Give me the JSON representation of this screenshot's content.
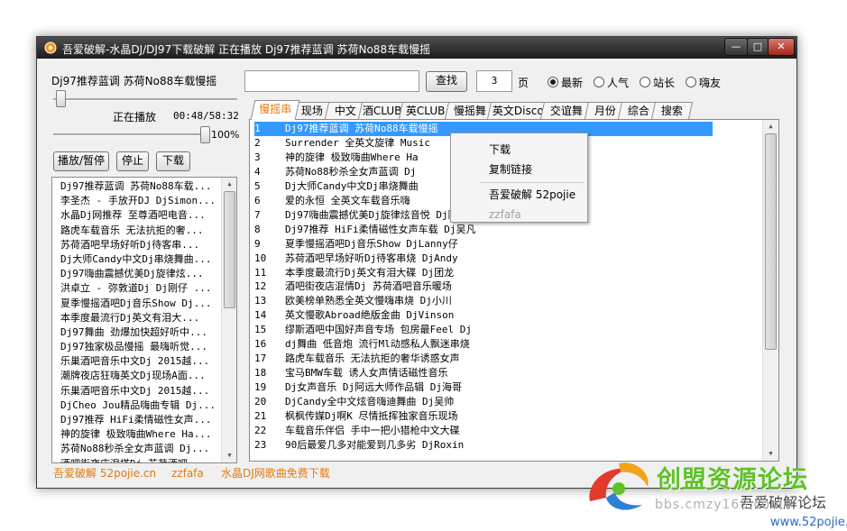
{
  "window": {
    "title": "吾爱破解-水晶DJ/DJ97下载破解 正在播放 Dj97推荐蓝调 苏荷No88车载慢摇"
  },
  "player": {
    "now_title": "Dj97推荐蓝调 苏荷No88车载慢摇",
    "status_label": "正在播放",
    "time": "00:48/58:32",
    "volume": "100%",
    "progress": 0.014,
    "volume_level": 1.0,
    "play_pause": "播放/暂停",
    "stop": "停止",
    "download": "下载"
  },
  "search": {
    "value": "",
    "button": "查找",
    "page": "3",
    "page_suffix": "页"
  },
  "sort": [
    {
      "label": "最新",
      "checked": true
    },
    {
      "label": "人气",
      "checked": false
    },
    {
      "label": "站长",
      "checked": false
    },
    {
      "label": "嗨友",
      "checked": false
    }
  ],
  "tabs": [
    "慢摇串",
    "现场",
    "中文",
    "酒CLUB",
    "英CLUB",
    "慢摇舞",
    "英文Disco",
    "交谊舞",
    "月份",
    "综合",
    "搜索"
  ],
  "active_tab": 0,
  "playlist": [
    "Dj97推荐蓝调 苏荷No88车载...",
    "李圣杰 - 手放开DJ DjSimon...",
    "水晶Dj网推荐 至尊酒吧电音...",
    "路虎车载音乐 无法抗拒的奢...",
    "苏荷酒吧早场好听Dj待客串...",
    "Dj大师Candy中文Dj串烧舞曲...",
    "Dj97嗨曲震撼优美Dj旋律炫...",
    "洪卓立 - 弥敦道Dj Dj刚仔 ...",
    "夏季慢摇酒吧Dj音乐Show Dj...",
    "本季度最流行Dj英文有泪大...",
    "Dj97舞曲 劲爆加快超好听中...",
    "Dj97独家极品慢摇 最嗨听觉...",
    "乐巢酒吧音乐中文Dj 2015越...",
    "潮牌夜店狂嗨英文Dj现场A面...",
    "乐巢酒吧音乐中文Dj 2015越...",
    "DjCheo Jou精品嗨曲专辑 Dj...",
    "Dj97推荐 HiFi柔情磁性女声...",
    "神的旋律 极致嗨曲Where Ha...",
    "苏荷No88秒杀全女声蓝调 Dj...",
    "酒吧街夜店混搭Dj 苏荷酒吧..."
  ],
  "tracks": [
    {
      "no": "1",
      "title": "Dj97推荐蓝调 苏荷No88车载慢摇"
    },
    {
      "no": "2",
      "title": "Surrender 全英文旋律 Music"
    },
    {
      "no": "3",
      "title": "神的旋律 极致嗨曲Where Ha"
    },
    {
      "no": "4",
      "title": "苏荷No88秒杀全女声蓝调 Dj"
    },
    {
      "no": "5",
      "title": "Dj大师Candy中文Dj串烧舞曲"
    },
    {
      "no": "6",
      "title": "爱的永恒 全英文车载音乐嗨"
    },
    {
      "no": "7",
      "title": "Dj97嗨曲震撼优美Dj旋律炫音悦 Dj阿文"
    },
    {
      "no": "8",
      "title": "Dj97推荐 HiFi柔情磁性女声车载 Dj吴凡"
    },
    {
      "no": "9",
      "title": "夏季慢摇酒吧Dj音乐Show DjLanny仔"
    },
    {
      "no": "10",
      "title": "苏荷酒吧早场好听Dj待客串烧 DjAndy"
    },
    {
      "no": "11",
      "title": "本季度最流行Dj英文有泪大碟 Dj团龙"
    },
    {
      "no": "12",
      "title": "酒吧街夜店混情Dj 苏荷酒吧音乐暖场"
    },
    {
      "no": "13",
      "title": "欧美榜单熟悉全英文慢嗨串烧 Dj小川"
    },
    {
      "no": "14",
      "title": "英文慢歌Abroad绝版金曲 DjVinson"
    },
    {
      "no": "15",
      "title": "缪斯酒吧中国好声音专场 包房最Feel Dj"
    },
    {
      "no": "16",
      "title": "dj舞曲 低音炮 流行Ml动感私人飘迷串烧"
    },
    {
      "no": "17",
      "title": "路虎车载音乐 无法抗拒的奢华诱惑女声"
    },
    {
      "no": "18",
      "title": "宝马BMW车载 诱人女声情话磁性音乐"
    },
    {
      "no": "19",
      "title": "Dj女声音乐 Dj阿远大师作品辑 Dj海哥"
    },
    {
      "no": "20",
      "title": "DjCandy全中文炫音嗨迪舞曲 Dj吴帅"
    },
    {
      "no": "21",
      "title": "枫枫传媒Dj啊K 尽情抵挥独家音乐现场"
    },
    {
      "no": "22",
      "title": "车载音乐伴侣 手中一把小猎枪中文大碟"
    },
    {
      "no": "23",
      "title": "90后最爱几多对能爱到几多劣 DjRoxin"
    }
  ],
  "context_menu": [
    {
      "label": "下载",
      "enabled": true
    },
    {
      "label": "复制链接",
      "enabled": true
    },
    {
      "label": "吾爱破解 52pojie",
      "enabled": true
    },
    {
      "label": "zzfafa",
      "enabled": false
    }
  ],
  "status": {
    "site": "吾爱破解 52pojie.cn",
    "author": "zzfafa",
    "note": "水晶DJ网歌曲免费下载"
  },
  "watermark": {
    "main": "创盟资源论坛",
    "bbs": "bbs.cmzy168.com",
    "site": "www.52pojie.cn",
    "behind": "吾爱破解论坛"
  },
  "colors": {
    "accent": "#e07a10",
    "selection": "#3399ff",
    "watermark_green": "#5fc22a"
  }
}
